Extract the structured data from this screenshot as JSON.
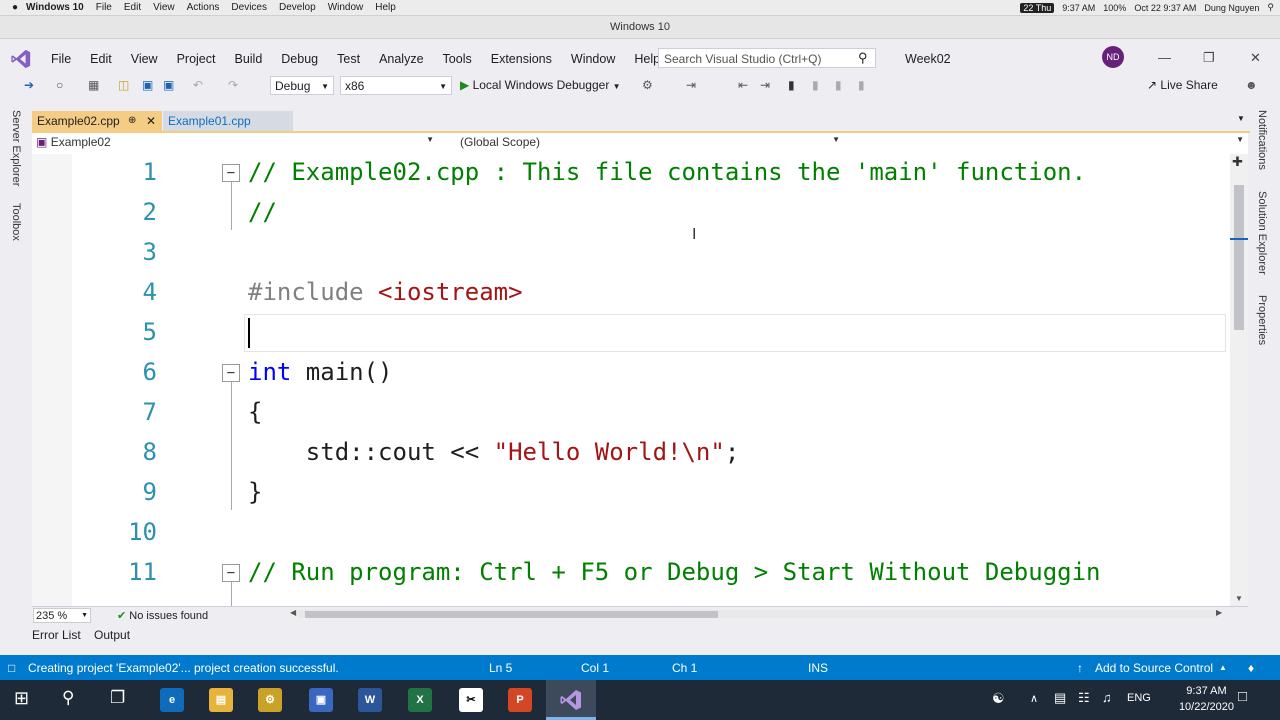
{
  "mac_menu": {
    "apple": "",
    "app": "Windows 10",
    "items": [
      "File",
      "Edit",
      "View",
      "Actions",
      "Devices",
      "Develop",
      "Window",
      "Help"
    ],
    "status": {
      "date": "22 Thu",
      "time": "9:37 AM",
      "battery": "100%",
      "datetime": "Oct 22 9:37 AM",
      "user": "Dung Nguyen"
    }
  },
  "window_title": "Windows 10",
  "vs": {
    "menu": [
      "File",
      "Edit",
      "View",
      "Project",
      "Build",
      "Debug",
      "Test",
      "Analyze",
      "Tools",
      "Extensions",
      "Window",
      "Help"
    ],
    "search_placeholder": "Search Visual Studio (Ctrl+Q)",
    "solution_name": "Week02",
    "avatar_initials": "ND",
    "config": "Debug",
    "platform": "x86",
    "run_label": "Local Windows Debugger",
    "live_share": "Live Share"
  },
  "side_left": [
    "Server Explorer",
    "Toolbox"
  ],
  "side_right": [
    "Notifications",
    "Solution Explorer",
    "Properties"
  ],
  "tabs": [
    {
      "label": "Example02.cpp",
      "active": true
    },
    {
      "label": "Example01.cpp",
      "active": false
    }
  ],
  "navbar": {
    "project": "Example02",
    "scope": "(Global Scope)"
  },
  "code_lines": [
    {
      "n": "1",
      "text": "// Example02.cpp : This file contains the 'main' function."
    },
    {
      "n": "2",
      "text": "//"
    },
    {
      "n": "3",
      "text": ""
    },
    {
      "n": "4",
      "pp": "#include ",
      "str": "<iostream>"
    },
    {
      "n": "5",
      "text": ""
    },
    {
      "n": "6",
      "kw": "int",
      "text": " main()"
    },
    {
      "n": "7",
      "text": "{"
    },
    {
      "n": "8",
      "text": "    std::cout << ",
      "str": "\"Hello World!\\n\"",
      "tail": ";"
    },
    {
      "n": "9",
      "text": "}"
    },
    {
      "n": "10",
      "text": ""
    },
    {
      "n": "11",
      "text": "// Run program: Ctrl + F5 or Debug > Start Without Debuggin"
    }
  ],
  "editor_bottom": {
    "zoom": "235 %",
    "issues": "No issues found"
  },
  "output_tabs": [
    "Error List",
    "Output"
  ],
  "status_bar": {
    "message": "Creating project 'Example02'... project creation successful.",
    "ln": "Ln 5",
    "col": "Col 1",
    "ch": "Ch 1",
    "mode": "INS",
    "source_control": "Add to Source Control"
  },
  "taskbar": {
    "lang": "ENG",
    "time": "9:37 AM",
    "date": "10/22/2020"
  }
}
